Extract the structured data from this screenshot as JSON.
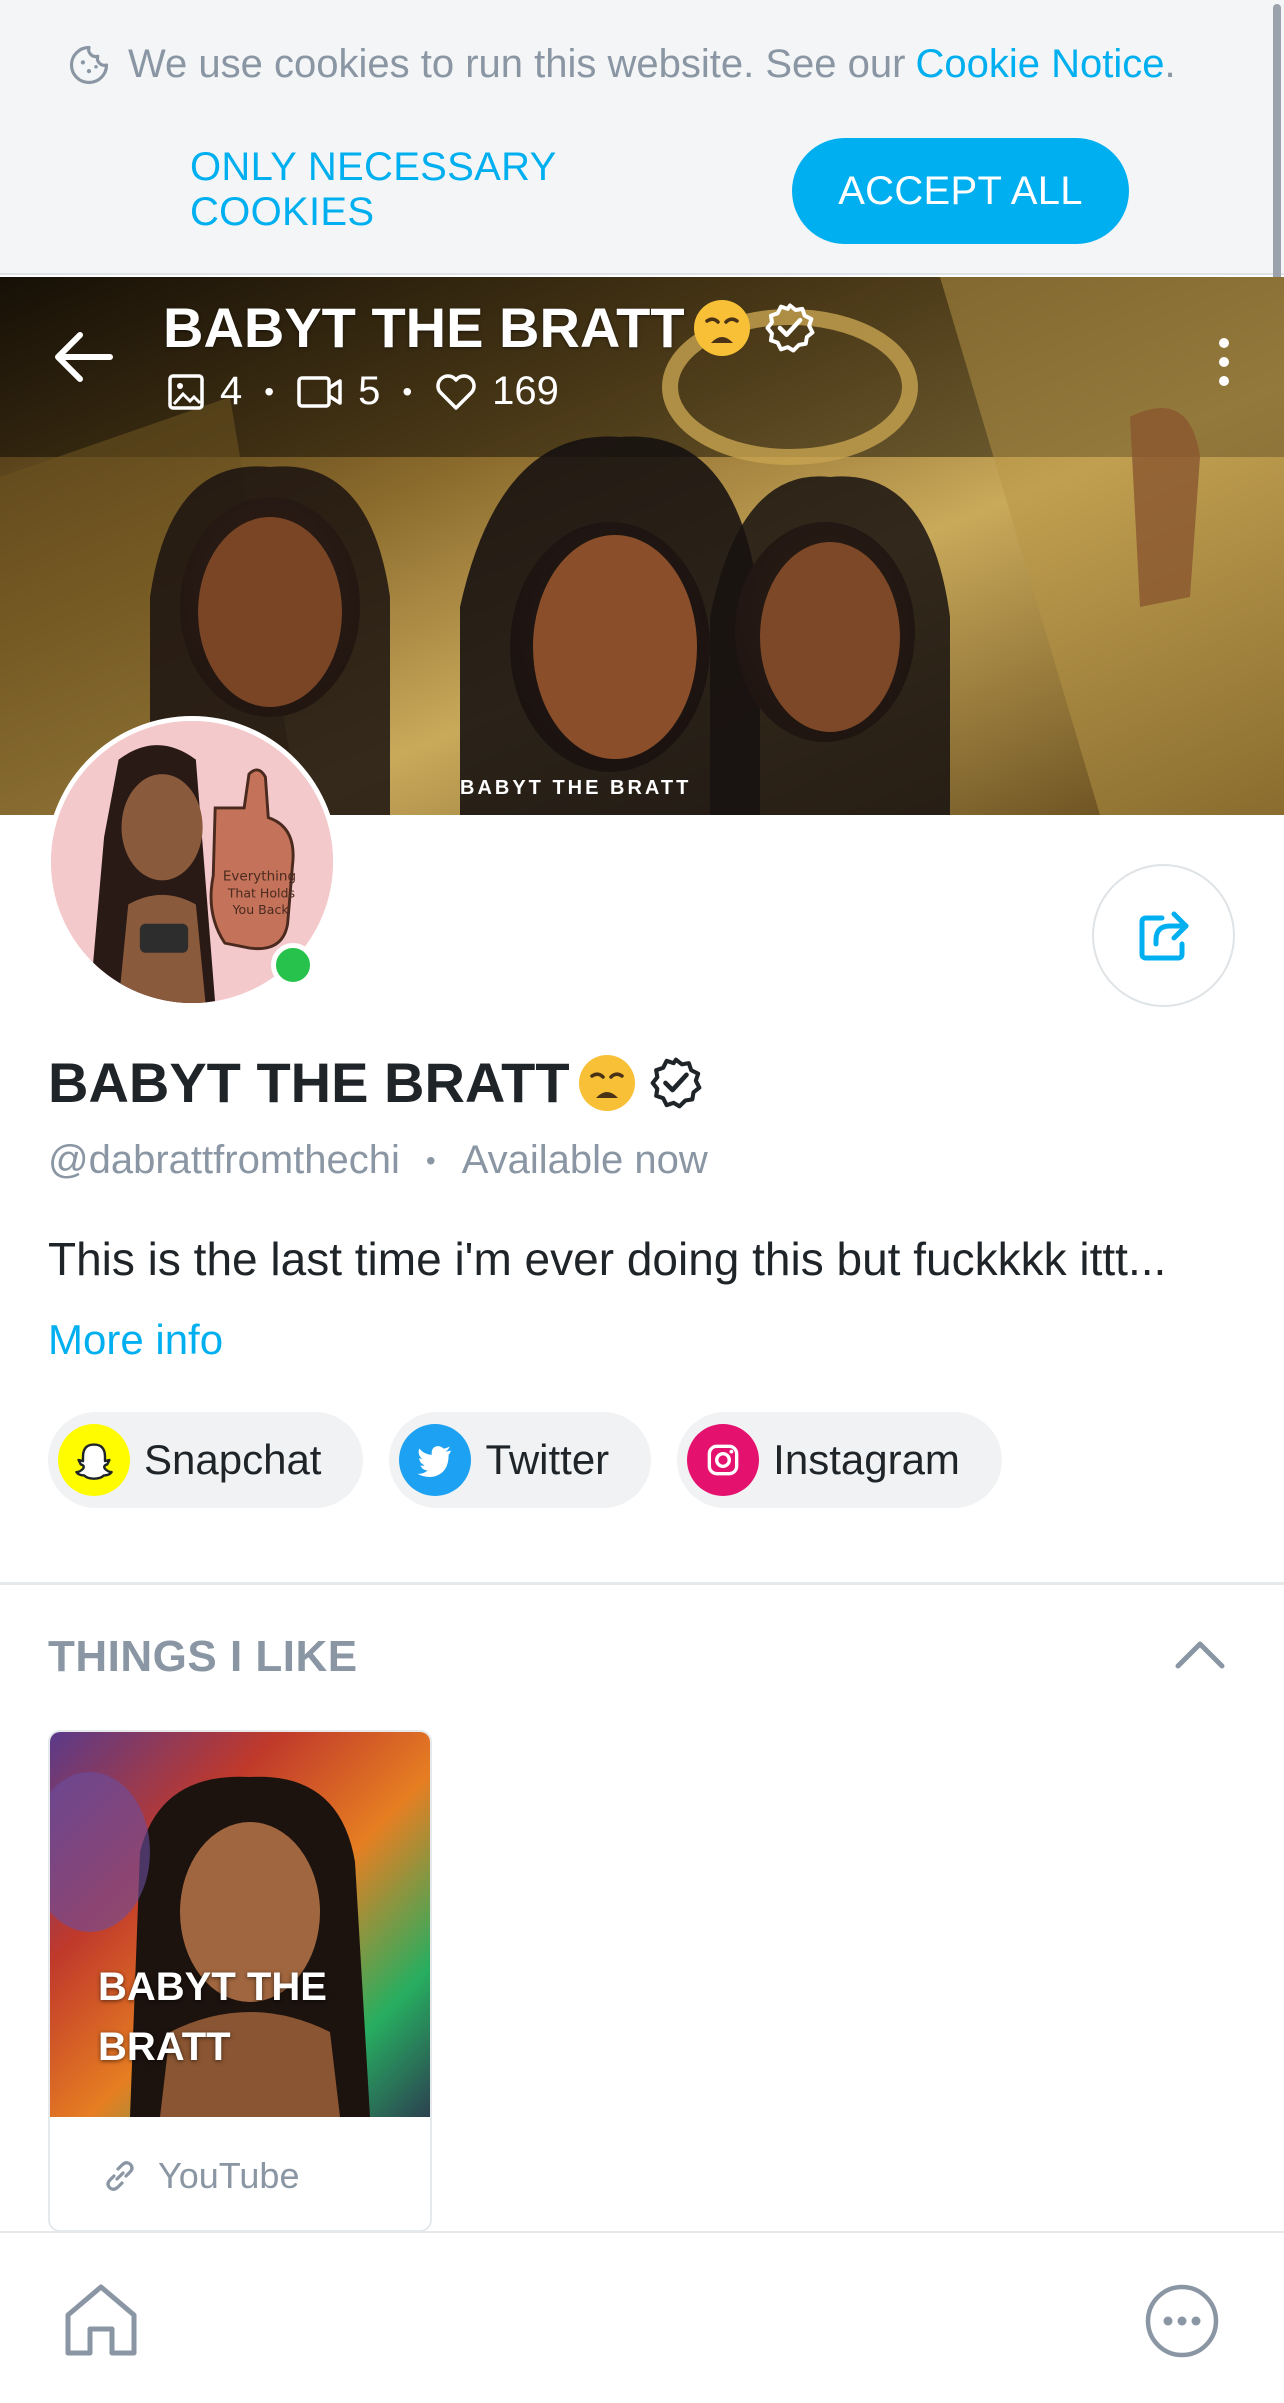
{
  "cookie_banner": {
    "text": "We use cookies to run this website. See our",
    "link": "Cookie Notice",
    "link_suffix": ".",
    "necessary_label": "ONLY NECESSARY COOKIES",
    "accept_label": "ACCEPT ALL",
    "icon": "cookie-icon"
  },
  "header": {
    "title": "BABYT THE BRATT",
    "stats": {
      "photos": "4",
      "videos": "5",
      "likes": "169"
    },
    "watermark": "BABYT THE BRATT",
    "icons": [
      "back-arrow-icon",
      "more-vertical-icon",
      "image-icon",
      "video-icon",
      "heart-icon",
      "verified-icon"
    ]
  },
  "profile": {
    "name": "BABYT THE BRATT",
    "handle": "@dabrattfromthechi",
    "status": "Available now",
    "bio": "This is the last time i'm ever doing this but fuckkkk ittt...",
    "more_info": "More info",
    "online": true
  },
  "socials": [
    {
      "label": "Snapchat",
      "icon": "snapchat-icon",
      "color": "#fffc00"
    },
    {
      "label": "Twitter",
      "icon": "twitter-icon",
      "color": "#1da1f2"
    },
    {
      "label": "Instagram",
      "icon": "instagram-icon",
      "color": "#e1306c"
    }
  ],
  "things_i_like": {
    "title": "THINGS I LIKE",
    "items": [
      {
        "title": "BABYT THE BRATT",
        "source": "YouTube",
        "icon": "link-icon"
      }
    ]
  },
  "bottom_nav": {
    "icons": [
      "home-icon",
      "more-horizontal-icon"
    ]
  },
  "colors": {
    "accent": "#00aff0",
    "muted": "#8a96a3",
    "online": "#27c24c"
  }
}
